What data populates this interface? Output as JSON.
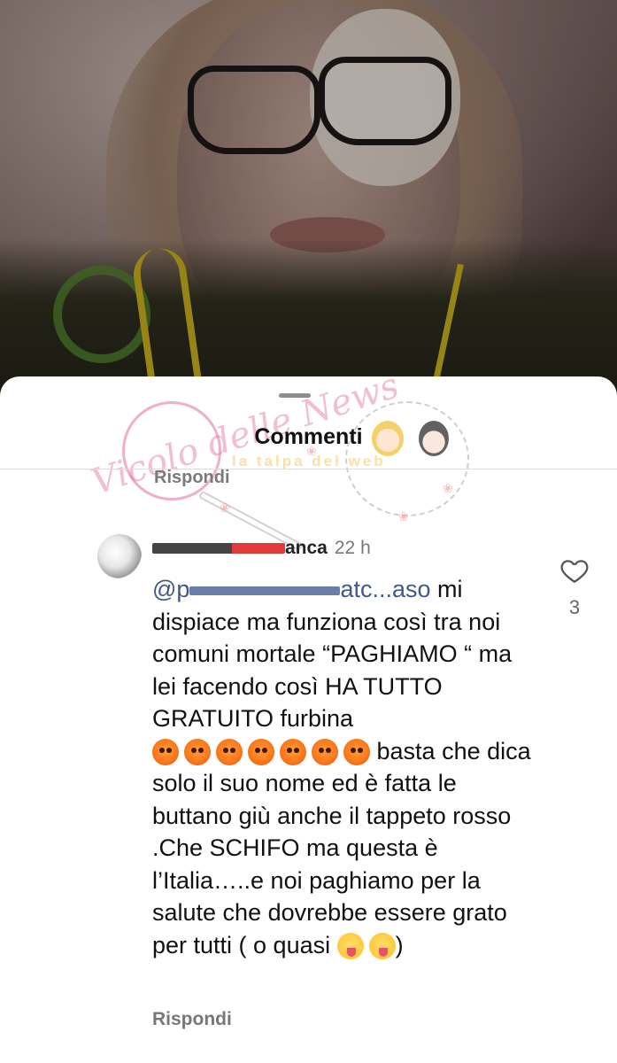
{
  "sheet": {
    "title": "Commenti",
    "reply_top": "Rispondi"
  },
  "watermark": {
    "brand": "Vicolo delle News",
    "tagline": "la talpa del web"
  },
  "comment": {
    "username_visible": "anca",
    "time": "22 h",
    "mention_visible": "@p",
    "mention_tail": "atc...aso",
    "text_1": "mi dispiace ma funziona così tra noi comuni mortale “PAGHIAMO “ ma lei facendo così HA TUTTO GRATUITO furbina",
    "text_2": "basta che dica solo il suo nome ed è fatta le buttano giù anche il tappeto rosso .Che SCHIFO ma questa è l’Italia…..e noi paghiamo per la salute che dovrebbe essere grato per tutti ( o quasi",
    "text_3": ")",
    "emoji_angry_count": 7,
    "emoji_tongue_count": 2,
    "likes": "3",
    "reply_label": "Rispondi",
    "icons": {
      "like": "heart-outline-icon"
    }
  },
  "colors": {
    "sheet_bg": "#ffffff",
    "mention": "#3f5a8a",
    "muted": "#777777",
    "watermark_pink": "#e26ea0"
  }
}
